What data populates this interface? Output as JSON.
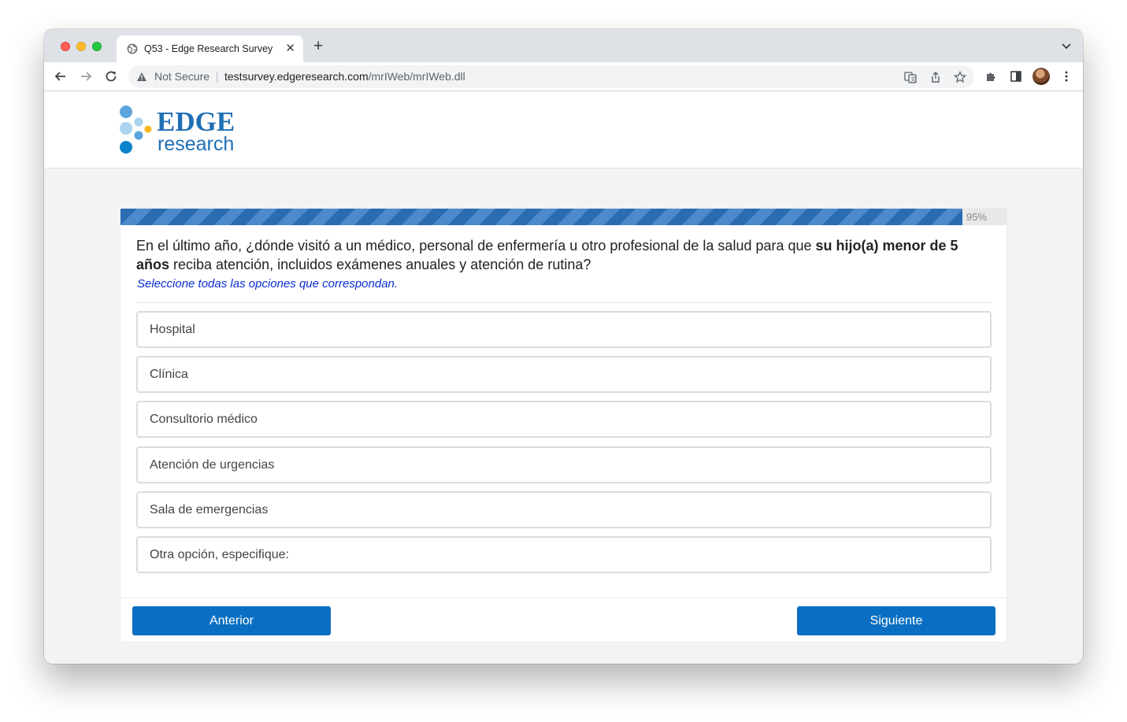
{
  "browser": {
    "tab_title": "Q53 - Edge Research Survey",
    "new_tab_icon": "plus-icon",
    "not_secure_label": "Not Secure",
    "url_host": "testsurvey.edgeresearch.com",
    "url_path": "/mrIWeb/mrIWeb.dll"
  },
  "logo": {
    "word1": "EDGE",
    "word2": "research",
    "colors": [
      "#1f6fb5",
      "#5aa6dc",
      "#a9d3ef",
      "#f7b51b",
      "#0a83cc"
    ]
  },
  "progress": {
    "value": 0.95,
    "label": "95%"
  },
  "question": {
    "text_before": "En el último año, ¿dónde visitó a un médico, personal de enfermería u otro profesional de la salud para que ",
    "text_bold": "su hijo(a) menor de 5 años",
    "text_after": " reciba atención, incluidos exámenes anuales y atención de rutina?",
    "instruction": "Seleccione todas las opciones que correspondan."
  },
  "options": [
    "Hospital",
    "Clínica",
    "Consultorio médico",
    "Atención de urgencias",
    "Sala de emergencias",
    "Otra opción, especifique:"
  ],
  "buttons": {
    "previous": "Anterior",
    "next": "Siguiente",
    "color": "#0a6fc2"
  }
}
